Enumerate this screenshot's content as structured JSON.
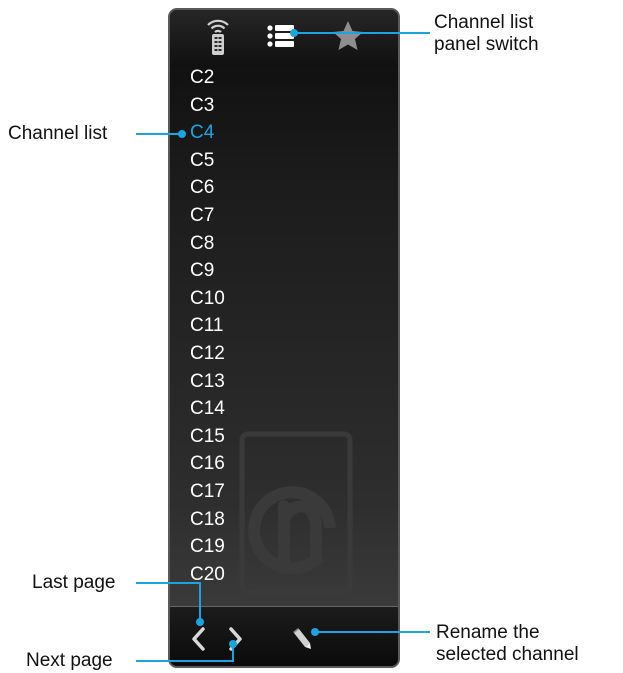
{
  "panel": {
    "tabs": [
      {
        "name": "remote",
        "icon": "remote-icon"
      },
      {
        "name": "channel-list",
        "icon": "list-icon"
      },
      {
        "name": "favorites",
        "icon": "star-icon"
      }
    ],
    "channels": [
      "C2",
      "C3",
      "C4",
      "C5",
      "C6",
      "C7",
      "C8",
      "C9",
      "C10",
      "C11",
      "C12",
      "C13",
      "C14",
      "C15",
      "C16",
      "C17",
      "C18",
      "C19",
      "C20"
    ],
    "selected_channel": "C4",
    "footer": {
      "prev_icon": "chevron-left-icon",
      "next_icon": "chevron-right-icon",
      "rename_icon": "pencil-icon"
    }
  },
  "callouts": {
    "panel_switch": "Channel list\npanel switch",
    "channel_list": "Channel list",
    "last_page": "Last page",
    "next_page": "Next page",
    "rename": "Rename the\nselected channel"
  },
  "colors": {
    "selected": "#1aa5e1",
    "leader": "#1aa5e1",
    "text": "#ffffff"
  }
}
